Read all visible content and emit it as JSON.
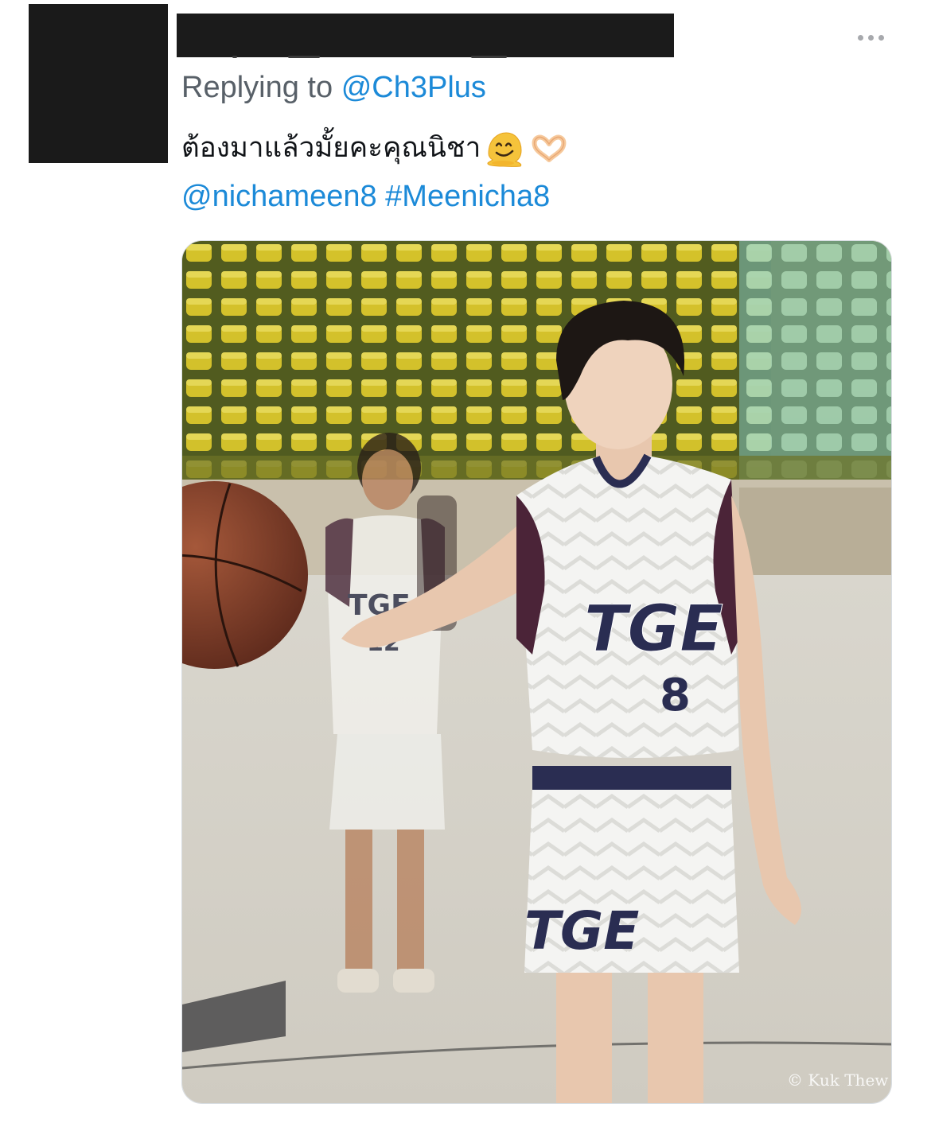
{
  "tweet": {
    "replying_to_prefix": "Replying to",
    "replying_to_handle": "@Ch3Plus",
    "text": "ต้องมาแล้วมั้ยคะคุณนิชา",
    "emojis": [
      "melting-face-emoji",
      "heart-hands-emoji"
    ],
    "mention": "@nichameen8",
    "hashtag": "#Meenicha8",
    "more_icon": "more-horizontal-icon"
  },
  "photo": {
    "jersey_text_front": "TGE",
    "jersey_number_front": "8",
    "jersey_text_back": "TGE",
    "jersey_number_back": "12",
    "shorts_text": "TGE",
    "watermark": "© Kuk Thew"
  },
  "colors": {
    "link_blue": "#1c8ad8",
    "muted_text": "#586068",
    "body_text": "#111418",
    "redaction": "#1a1a1a"
  }
}
